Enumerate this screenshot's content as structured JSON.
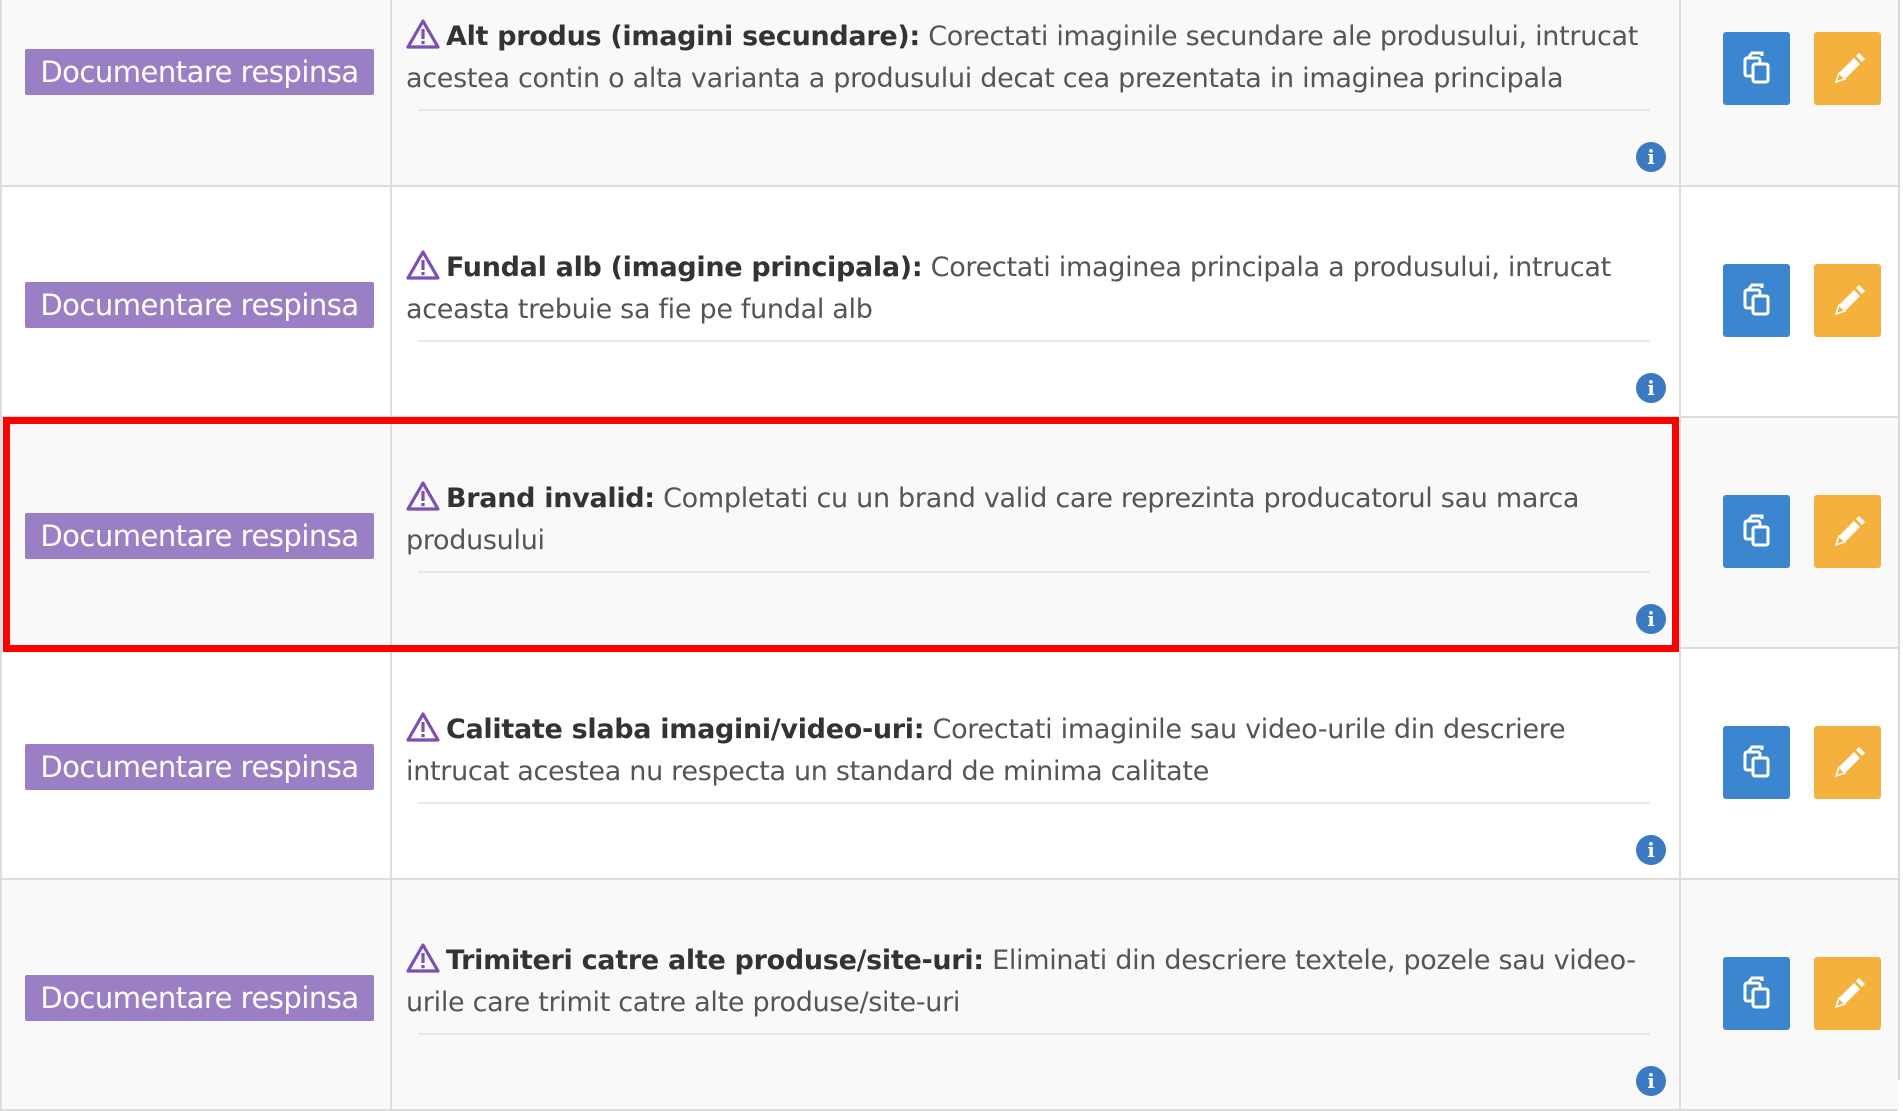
{
  "rows": [
    {
      "status_label": "Documentare respinsa",
      "issue_title": "Alt produs (imagini secundare):",
      "issue_text": " Corectati imaginile secundare ale produsului, intrucat acestea contin o alta varianta a produsului decat cea prezentata in imaginea principala",
      "info_icon": "i"
    },
    {
      "status_label": "Documentare respinsa",
      "issue_title": "Fundal alb (imagine principala):",
      "issue_text": " Corectati imaginea principala a produsului, intrucat aceasta trebuie sa fie pe fundal alb",
      "info_icon": "i"
    },
    {
      "status_label": "Documentare respinsa",
      "issue_title": "Brand invalid:",
      "issue_text": " Completati cu un brand valid care reprezinta producatorul sau marca produsului",
      "info_icon": "i",
      "highlighted": true
    },
    {
      "status_label": "Documentare respinsa",
      "issue_title": "Calitate slaba imagini/video-uri:",
      "issue_text": " Corectati imaginile sau video-urile din descriere intrucat acestea nu respecta un standard de minima calitate",
      "info_icon": "i"
    },
    {
      "status_label": "Documentare respinsa",
      "issue_title": "Trimiteri catre alte produse/site-uri:",
      "issue_text": " Eliminati din descriere textele, pozele sau video-urile care trimit catre alte produse/site-uri",
      "info_icon": "i"
    }
  ],
  "icons": {
    "warning": "warning-triangle-icon",
    "info": "info-circle-icon",
    "copy": "copy-icon",
    "edit": "pencil-icon"
  },
  "colors": {
    "status_label_bg": "#9b7fc4",
    "copy_button_bg": "#3c86cf",
    "edit_button_bg": "#f5b13e",
    "info_icon_bg": "#3b7ac3",
    "warning_icon": "#7b4fb3",
    "highlight_border": "#ff0000"
  }
}
